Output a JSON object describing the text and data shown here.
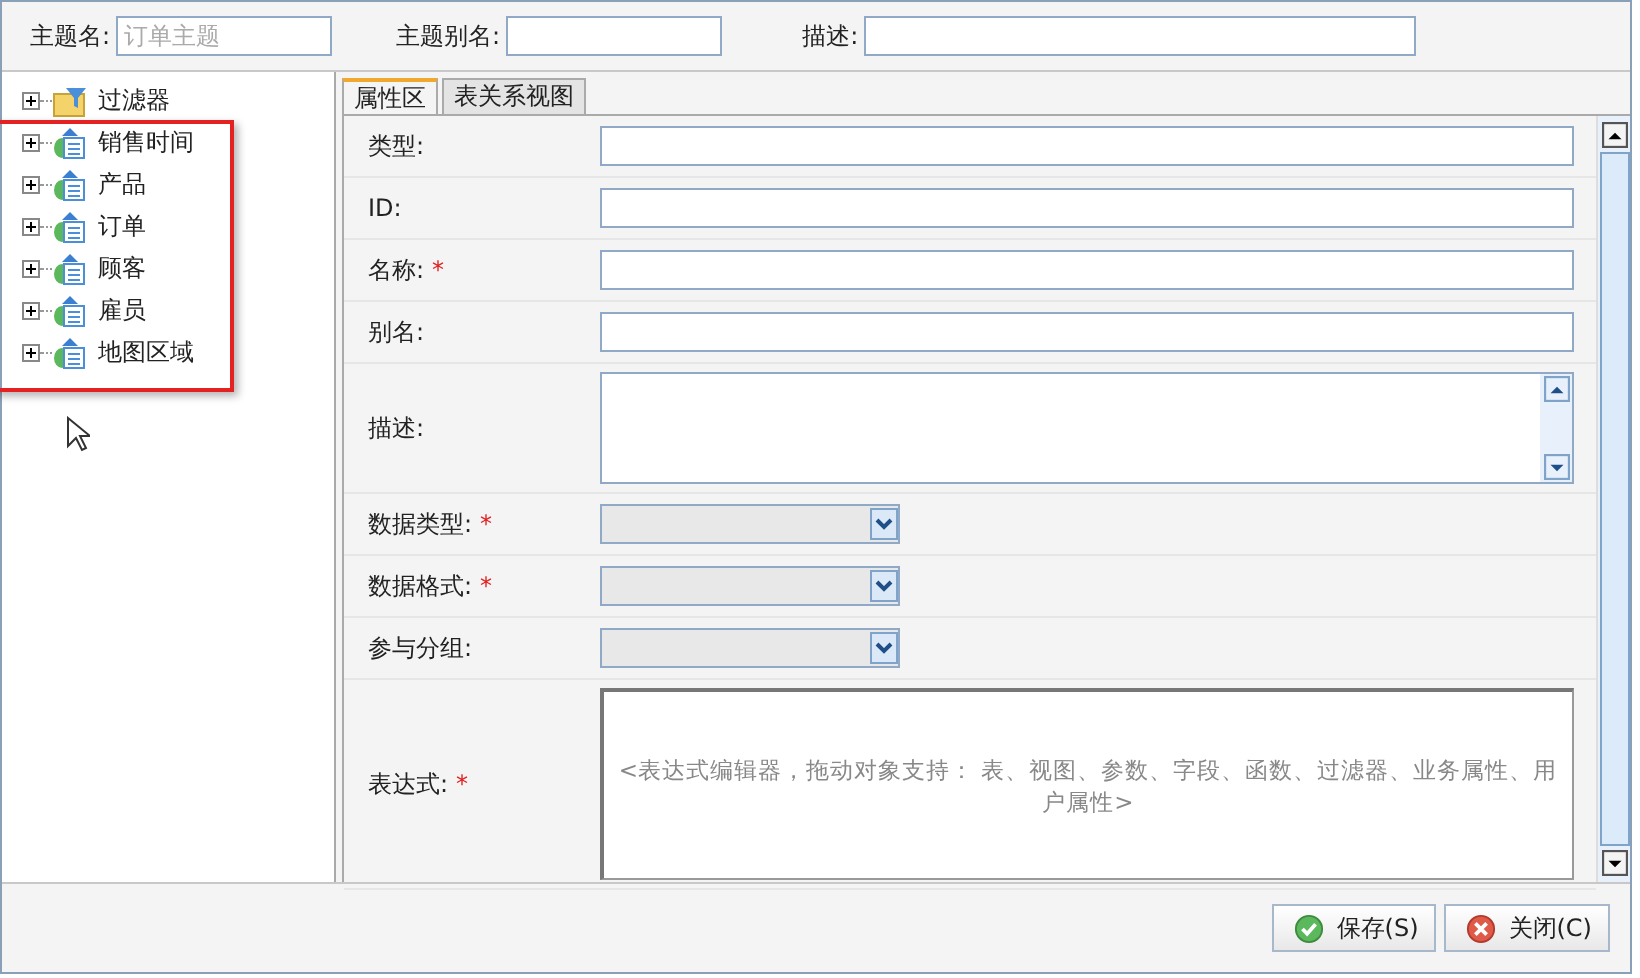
{
  "header": {
    "fields": [
      {
        "label": "主题名:",
        "placeholder": "订单主题",
        "kind": "short"
      },
      {
        "label": "主题别名:",
        "kind": "short"
      },
      {
        "label": "描述:",
        "kind": "long"
      }
    ]
  },
  "tree": {
    "items": [
      {
        "label": "过滤器",
        "kind": "filter",
        "expanded": false
      },
      {
        "label": "销售时间",
        "kind": "dimension",
        "expanded": false
      },
      {
        "label": "产品",
        "kind": "dimension",
        "expanded": false
      },
      {
        "label": "订单",
        "kind": "dimension",
        "expanded": false
      },
      {
        "label": "顾客",
        "kind": "dimension",
        "expanded": false
      },
      {
        "label": "雇员",
        "kind": "dimension",
        "expanded": false
      },
      {
        "label": "地图区域",
        "kind": "dimension",
        "expanded": false
      }
    ]
  },
  "tabs": [
    {
      "label": "属性区",
      "selected": true
    },
    {
      "label": "表关系视图",
      "selected": false
    }
  ],
  "form": {
    "fields": [
      {
        "label": "类型:",
        "kind": "text"
      },
      {
        "label": "ID:",
        "kind": "text"
      },
      {
        "label": "名称:",
        "kind": "text",
        "required_mark": "*"
      },
      {
        "label": "别名:",
        "kind": "text"
      },
      {
        "label": "描述:",
        "kind": "textarea"
      },
      {
        "label": "数据类型:",
        "kind": "select",
        "required_mark": "*"
      },
      {
        "label": "数据格式:",
        "kind": "select",
        "required_mark": "*"
      },
      {
        "label": "参与分组:",
        "kind": "select"
      },
      {
        "label": "表达式:",
        "kind": "expression",
        "required_mark": "*",
        "placeholder": "<表达式编辑器，拖动对象支持：   表、视图、参数、字段、函数、过滤器、业务属性、用户属性>"
      }
    ]
  },
  "buttons": [
    {
      "label": "保存(S)",
      "kind": "save"
    },
    {
      "label": "关闭(C)",
      "kind": "close"
    }
  ]
}
